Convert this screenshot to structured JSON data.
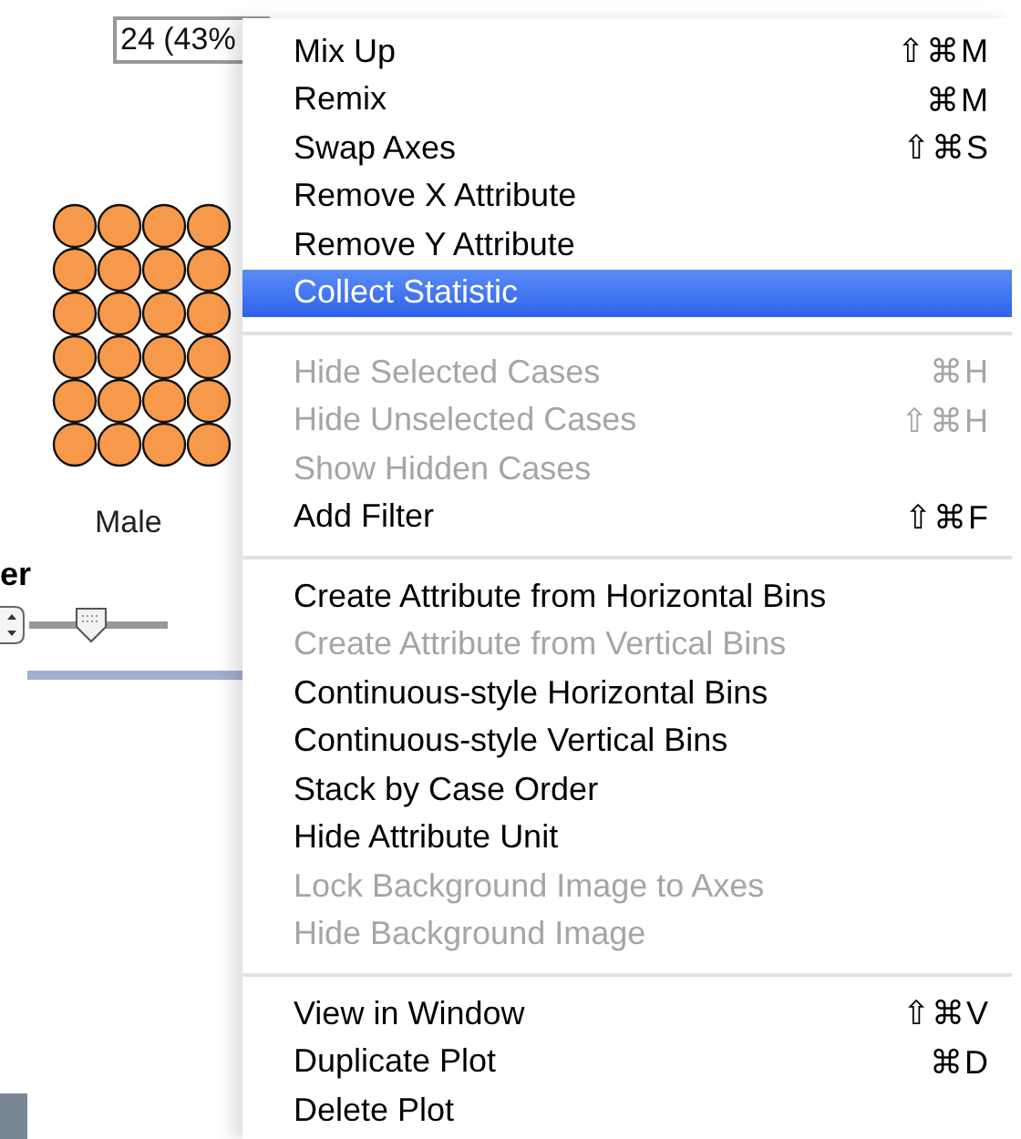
{
  "count_field": {
    "value": "24 (43%"
  },
  "dot_plot": {
    "category_label": "Male"
  },
  "panel_heading": "er",
  "size_slider": {
    "level": 0.45
  },
  "context_menu": {
    "sections": [
      {
        "items": [
          {
            "label": "Mix Up",
            "shortcut": "⇧⌘M",
            "disabled": false,
            "selected": false
          },
          {
            "label": "Remix",
            "shortcut": "⌘M",
            "disabled": false,
            "selected": false
          },
          {
            "label": "Swap Axes",
            "shortcut": "⇧⌘S",
            "disabled": false,
            "selected": false
          },
          {
            "label": "Remove X Attribute",
            "disabled": false,
            "selected": false
          },
          {
            "label": "Remove Y Attribute",
            "disabled": false,
            "selected": false
          },
          {
            "label": "Collect Statistic",
            "disabled": false,
            "selected": true
          }
        ]
      },
      {
        "items": [
          {
            "label": "Hide Selected Cases",
            "shortcut": "⌘H",
            "disabled": true,
            "selected": false
          },
          {
            "label": "Hide Unselected Cases",
            "shortcut": "⇧⌘H",
            "disabled": true,
            "selected": false
          },
          {
            "label": "Show Hidden Cases",
            "disabled": true,
            "selected": false
          },
          {
            "label": "Add Filter",
            "shortcut": "⇧⌘F",
            "disabled": false,
            "selected": false
          }
        ]
      },
      {
        "items": [
          {
            "label": "Create Attribute from Horizontal Bins",
            "disabled": false,
            "selected": false
          },
          {
            "label": "Create Attribute from Vertical Bins",
            "disabled": true,
            "selected": false
          },
          {
            "label": "Continuous-style Horizontal Bins",
            "disabled": false,
            "selected": false
          },
          {
            "label": "Continuous-style Vertical Bins",
            "disabled": false,
            "selected": false
          },
          {
            "label": "Stack by Case Order",
            "disabled": false,
            "selected": false
          },
          {
            "label": "Hide Attribute Unit",
            "disabled": false,
            "selected": false
          },
          {
            "label": "Lock Background Image to Axes",
            "disabled": true,
            "selected": false
          },
          {
            "label": "Hide Background Image",
            "disabled": true,
            "selected": false
          }
        ]
      },
      {
        "items": [
          {
            "label": "View in Window",
            "shortcut": "⇧⌘V",
            "disabled": false,
            "selected": false
          },
          {
            "label": "Duplicate Plot",
            "shortcut": "⌘D",
            "disabled": false,
            "selected": false
          },
          {
            "label": "Delete Plot",
            "disabled": false,
            "selected": false
          }
        ]
      }
    ]
  }
}
